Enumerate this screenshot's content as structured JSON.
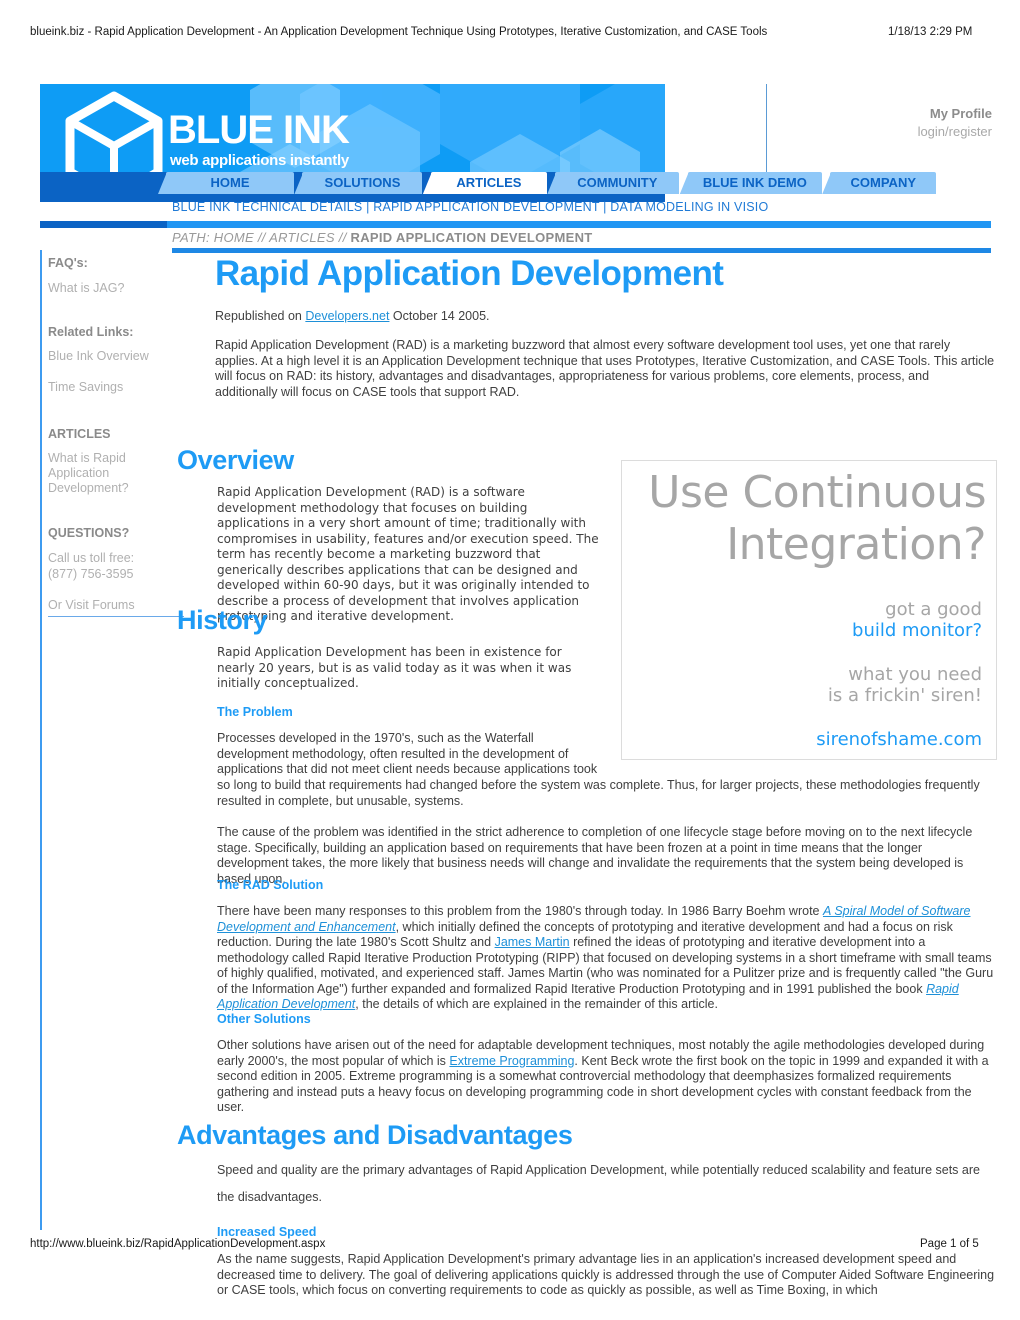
{
  "print": {
    "header_title": "blueink.biz - Rapid Application Development - An Application Development Technique Using Prototypes, Iterative Customization, and CASE Tools",
    "header_date": "1/18/13 2:29 PM",
    "footer_url": "http://www.blueink.biz/RapidApplicationDevelopment.aspx",
    "footer_page": "Page 1 of 5"
  },
  "brand": {
    "wordmark": "BLUE INK",
    "tagline": "web applications instantly"
  },
  "profile": {
    "title": "My Profile",
    "subtitle": "login/register"
  },
  "nav": {
    "tabs": [
      {
        "label": "HOME",
        "active": false
      },
      {
        "label": "SOLUTIONS",
        "active": false
      },
      {
        "label": "ARTICLES",
        "active": true
      },
      {
        "label": "COMMUNITY",
        "active": false
      },
      {
        "label": "BLUE INK DEMO",
        "active": false
      },
      {
        "label": "COMPANY",
        "active": false
      }
    ],
    "subnav": "BLUE INK TECHNICAL DETAILS | RAPID APPLICATION DEVELOPMENT | DATA MODELING IN VISIO"
  },
  "path": {
    "prefix": "PATH:  HOME // ARTICLES // ",
    "current": "RAPID APPLICATION DEVELOPMENT"
  },
  "sidebar": {
    "groups": [
      {
        "heading": "FAQ's:",
        "links": [
          "What is JAG?"
        ]
      },
      {
        "heading": "Related Links:",
        "links": [
          "Blue Ink Overview",
          "Time Savings"
        ]
      },
      {
        "heading": "ARTICLES",
        "links": [
          "What is Rapid\nApplication\nDevelopment?"
        ]
      },
      {
        "heading": "QUESTIONS?",
        "links": [
          "Call us toll free:\n(877) 756-3595",
          "Or Visit Forums"
        ]
      }
    ]
  },
  "article": {
    "title": "Rapid Application Development",
    "republished_prefix": "Republished on ",
    "republished_link": "Developers.net",
    "republished_suffix": " October 14 2005.",
    "intro": "Rapid Application Development (RAD) is a marketing buzzword that almost every software development tool uses, yet one that rarely applies. At a high level it is an Application Development technique that uses Prototypes, Iterative Customization, and CASE Tools. This article will focus on RAD: its history, advantages and disadvantages, appropriateness for various problems, core elements, process, and additionally will focus on CASE tools that support RAD.",
    "sections": {
      "overview_heading": "Overview",
      "overview_body": "Rapid Application Development (RAD) is a software development methodology that focuses on building applications in a very short amount of time; traditionally with compromises in usability, features and/or execution speed. The term has recently become a marketing buzzword that generically describes applications that can be designed and developed within 60-90 days, but it was originally intended to describe a process of development that involves application prototyping and iterative development.",
      "history_heading": "History",
      "history_body": "Rapid Application Development has been in existence for nearly 20 years, but is as valid today as it was when it was initially conceptualized.",
      "problem_heading": "The Problem",
      "problem_body_1": "Processes developed in the 1970's, such as the Waterfall development methodology, often resulted in the development of applications that did not meet client needs because applications took",
      "problem_body_1b": "so long to build that requirements had changed before the system was complete. Thus, for larger projects, these methodologies frequently resulted in complete, but unusable, systems.",
      "problem_body_2": "The cause of the problem was identified in the strict adherence to completion of one lifecycle stage before moving on to the next lifecycle stage. Specifically, building an application based on requirements that have been frozen at a point in time means that the longer development takes, the more likely that business needs will change and invalidate the requirements that the system being developed is based upon.",
      "rad_heading": "The RAD Solution",
      "rad_p1": "There have been many responses to this problem from the 1980's through today. In 1986 Barry Boehm wrote ",
      "rad_link1": "A Spiral Model of Software Development and Enhancement",
      "rad_p2": ", which initially defined the concepts of prototyping and iterative development and had a focus on risk reduction. During the late 1980's Scott Shultz and ",
      "rad_link2": "James Martin",
      "rad_p3": " refined the ideas of prototyping and iterative development into a methodology called Rapid Iterative Production Prototyping (RIPP) that focused on developing systems in a short timeframe with small teams of highly qualified, motivated, and experienced staff. James Martin (who was nominated for a Pulitzer prize and is frequently called \"the Guru of the Information Age\") further expanded and formalized Rapid Iterative Production Prototyping and in 1991 published the book ",
      "rad_link3": "Rapid Application Development",
      "rad_p4": ", the details of which are explained in the remainder of this article.",
      "other_heading": "Other Solutions",
      "other_p1": "Other solutions have arisen out of the need for adaptable development techniques, most notably the agile methodologies developed during early 2000's, the most popular of which is ",
      "other_link1": "Extreme Programming",
      "other_p2": ". Kent Beck wrote the first book on the topic in 1999 and expanded it with a second edition in 2005. Extreme programming is a somewhat controvercial methodology that deemphasizes formalized requirements gathering and instead puts a heavy focus on developing programming code in short development cycles with constant feedback from the user.",
      "adv_heading": "Advantages and Disadvantages",
      "adv_body_1": "Speed and quality are the primary advantages of Rapid Application Development, while potentially reduced scalability and feature sets are",
      "adv_body_2": "the disadvantages.",
      "speed_heading": "Increased Speed",
      "speed_body": "As the name suggests, Rapid Application Development's primary advantage lies in an application's increased development speed and decreased time to delivery. The goal of delivering applications quickly is addressed through the use of Computer Aided Software Engineering or CASE tools, which focus on converting requirements to code as quickly as possible, as well as Time Boxing, in which"
    }
  },
  "ad": {
    "headline_line1": "Use Continuous",
    "headline_line2": "Integration?",
    "line1": "got a good",
    "line2": "build monitor?",
    "line3": "what you need",
    "line4": "is a frickin' siren!",
    "url": "sirenofshame.com"
  },
  "colors": {
    "brand_blue": "#1e9bf5",
    "nav_dark_blue": "#0b63c4",
    "tab_blue": "#8fc8f8",
    "link_blue": "#1e90d8",
    "banner_blue": "#0e9cf5",
    "muted_gray": "#a8a8a8"
  }
}
